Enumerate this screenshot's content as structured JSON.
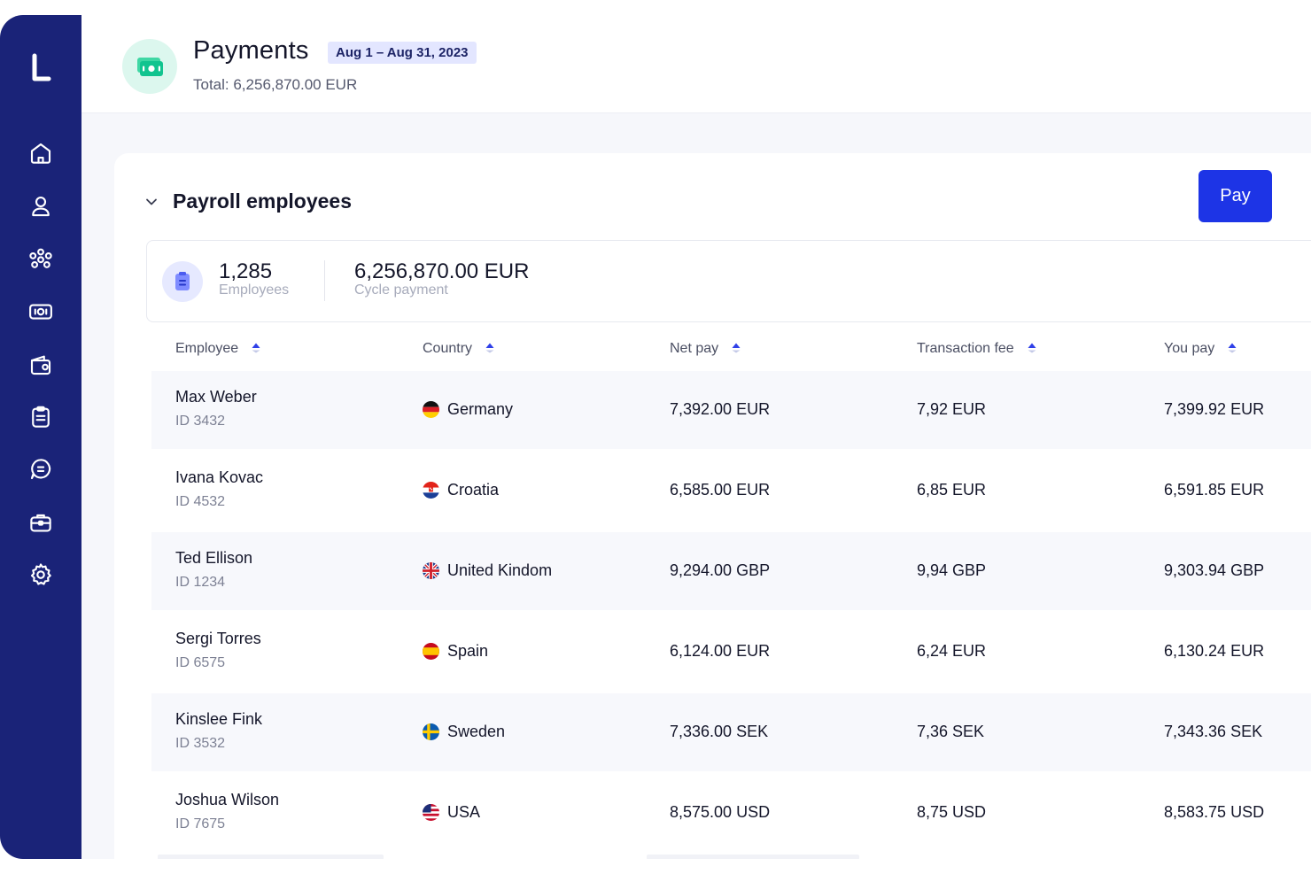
{
  "header": {
    "title": "Payments",
    "date_range": "Aug 1 – Aug 31, 2023",
    "total": "Total: 6,256,870.00 EUR"
  },
  "sidebar": {
    "logo": "L",
    "items": [
      {
        "icon": "home-icon"
      },
      {
        "icon": "user-icon"
      },
      {
        "icon": "team-icon"
      },
      {
        "icon": "payments-icon"
      },
      {
        "icon": "wallet-icon"
      },
      {
        "icon": "clipboard-icon"
      },
      {
        "icon": "chat-icon"
      },
      {
        "icon": "briefcase-icon"
      },
      {
        "icon": "gear-icon"
      }
    ]
  },
  "card": {
    "title": "Payroll employees",
    "pay_label": "Pay",
    "summary": {
      "employees_value": "1,285",
      "employees_label": "Employees",
      "cycle_value": "6,256,870.00 EUR",
      "cycle_label": "Cycle payment"
    }
  },
  "table": {
    "columns": [
      "Employee",
      "Country",
      "Net pay",
      "Transaction fee",
      "You pay"
    ],
    "rows": [
      {
        "name": "Max Weber",
        "id": "ID 3432",
        "country": "Germany",
        "flag": "de",
        "net": "7,392.00 EUR",
        "fee": "7,92 EUR",
        "total": "7,399.92 EUR"
      },
      {
        "name": "Ivana Kovac",
        "id": "ID 4532",
        "country": "Croatia",
        "flag": "hr",
        "net": "6,585.00 EUR",
        "fee": "6,85 EUR",
        "total": "6,591.85 EUR"
      },
      {
        "name": "Ted Ellison",
        "id": "ID 1234",
        "country": "United Kindom",
        "flag": "gb",
        "net": "9,294.00 GBP",
        "fee": "9,94 GBP",
        "total": "9,303.94 GBP"
      },
      {
        "name": "Sergi Torres",
        "id": "ID 6575",
        "country": "Spain",
        "flag": "es",
        "net": "6,124.00 EUR",
        "fee": "6,24 EUR",
        "total": "6,130.24 EUR"
      },
      {
        "name": "Kinslee Fink",
        "id": "ID 3532",
        "country": "Sweden",
        "flag": "se",
        "net": "7,336.00 SEK",
        "fee": "7,36 SEK",
        "total": "7,343.36 SEK"
      },
      {
        "name": "Joshua Wilson",
        "id": "ID 7675",
        "country": "USA",
        "flag": "us",
        "net": "8,575.00 USD",
        "fee": "8,75 USD",
        "total": "8,583.75 USD"
      }
    ]
  },
  "colors": {
    "sidebar": "#1a2378",
    "accent": "#1d34e6",
    "badge_bg": "#e3e6ff",
    "icon_green": "#dcf7ee"
  }
}
